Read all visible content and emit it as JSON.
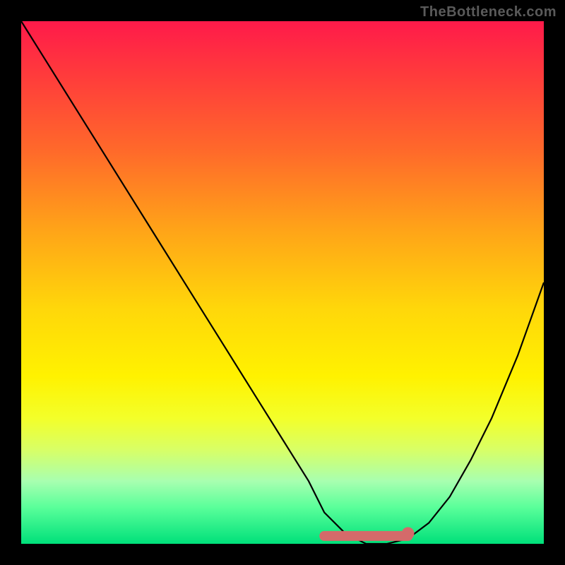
{
  "watermark": "TheBottleneck.com",
  "chart_data": {
    "type": "line",
    "title": "",
    "xlabel": "",
    "ylabel": "",
    "xlim": [
      0,
      100
    ],
    "ylim": [
      0,
      100
    ],
    "grid": false,
    "legend": false,
    "background_gradient": {
      "top": "#ff1a4a",
      "mid": "#fff200",
      "bottom": "#00e07a"
    },
    "series": [
      {
        "name": "bottleneck-curve",
        "color": "#000000",
        "x": [
          0,
          5,
          10,
          15,
          20,
          25,
          30,
          35,
          40,
          45,
          50,
          55,
          58,
          62,
          66,
          70,
          74,
          78,
          82,
          86,
          90,
          95,
          100
        ],
        "y": [
          100,
          92,
          84,
          76,
          68,
          60,
          52,
          44,
          36,
          28,
          20,
          12,
          6,
          2,
          0,
          0,
          1,
          4,
          9,
          16,
          24,
          36,
          50
        ]
      }
    ],
    "highlight_segment": {
      "name": "optimal-range",
      "color": "#d46a6a",
      "x_start": 58,
      "x_end": 74,
      "y": 1.5
    },
    "highlight_point": {
      "name": "optimal-end-dot",
      "color": "#d46a6a",
      "x": 74,
      "y": 2,
      "r": 1.2
    }
  }
}
